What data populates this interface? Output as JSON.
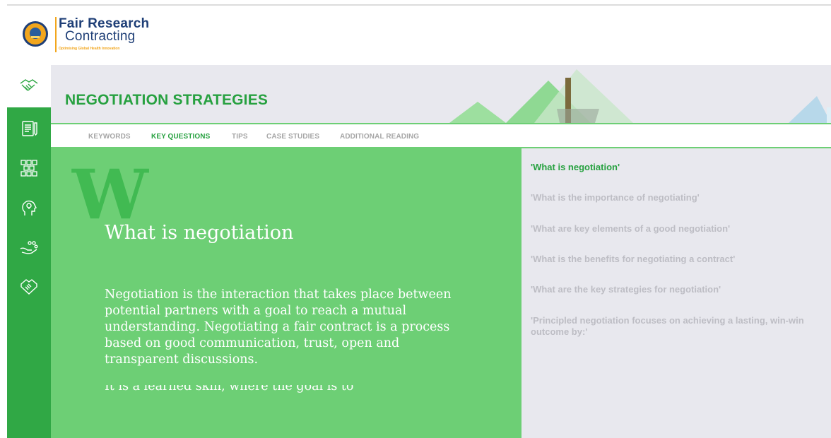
{
  "brand": {
    "name_line1": "Fair Research",
    "name_line2": "Contracting",
    "tagline": "Optimising Global Health Innovation",
    "colors": {
      "navy": "#1f3f77",
      "orange": "#f2a61d"
    }
  },
  "sidebar": {
    "items": [
      {
        "icon": "handshake-icon"
      },
      {
        "icon": "document-icon"
      },
      {
        "icon": "network-icon"
      },
      {
        "icon": "head-idea-icon"
      },
      {
        "icon": "hand-people-icon"
      },
      {
        "icon": "agreement-icon"
      }
    ]
  },
  "banner": {
    "title": "NEGOTIATION STRATEGIES"
  },
  "tabs": [
    {
      "label": "KEYWORDS",
      "active": false
    },
    {
      "label": "KEY QUESTIONS",
      "active": true
    },
    {
      "label": "TIPS",
      "active": false
    },
    {
      "label": "CASE STUDIES",
      "active": false
    },
    {
      "label": "ADDITIONAL READING",
      "active": false
    }
  ],
  "content": {
    "dropcap": "W",
    "title": "What is negotiation",
    "body": "Negotiation is the interaction that takes place between potential partners with a goal to reach a mutual understanding. Negotiating a fair contract is a process based on good communication, trust, open and transparent discussions.",
    "cut_off": "It is a learned skill, where the goal is to"
  },
  "questions": [
    {
      "label": "'What is negotiation'",
      "active": true
    },
    {
      "label": "'What is the importance of negotiating'",
      "active": false
    },
    {
      "label": "'What are key elements of a good negotiation'",
      "active": false
    },
    {
      "label": "'What is the benefits for negotiating a contract'",
      "active": false
    },
    {
      "label": "'What are the key strategies for negotiation'",
      "active": false
    },
    {
      "label": "'Principled negotiation focuses on achieving a lasting, win-win outcome by:'",
      "active": false
    }
  ],
  "colors": {
    "accent_green": "#27a140",
    "sidebar_green": "#30a845",
    "content_green": "#6dcf75",
    "panel_grey": "#e8e8ee"
  }
}
